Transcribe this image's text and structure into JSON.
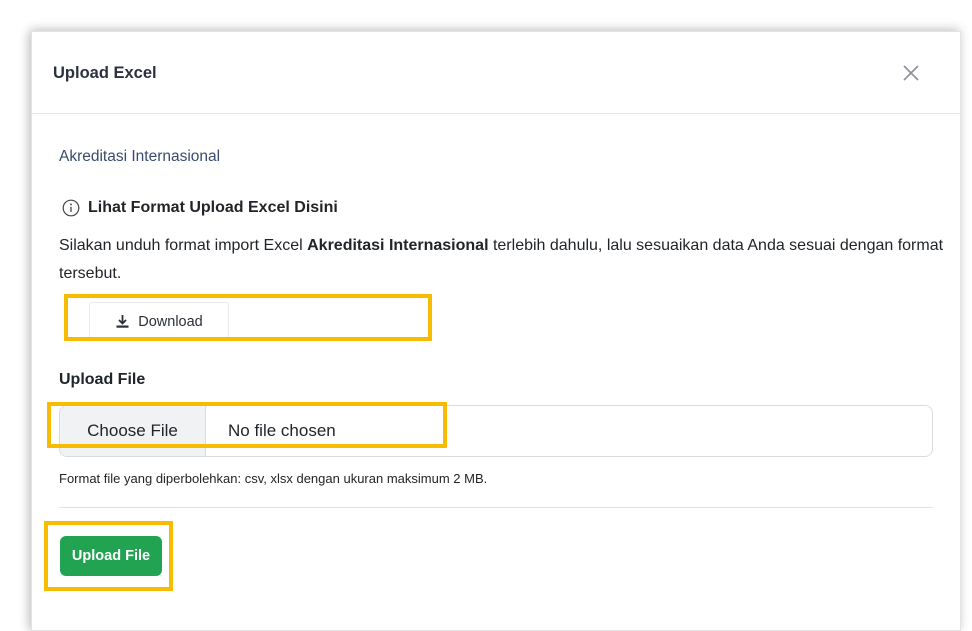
{
  "modal": {
    "title": "Upload Excel",
    "close_icon": "close-icon"
  },
  "body": {
    "subtitle": "Akreditasi Internasional",
    "info_icon": "info-circle-icon",
    "info_heading": "Lihat Format Upload Excel Disini",
    "description": {
      "before": "Silakan unduh format import Excel ",
      "bold": "Akreditasi Internasional",
      "after": " terlebih dahulu, lalu sesuaikan data Anda sesuai dengan format tersebut."
    },
    "download": {
      "icon": "download-icon",
      "label": "Download"
    }
  },
  "upload": {
    "label": "Upload File",
    "choose_button": "Choose File",
    "file_status": "No file chosen",
    "help_text": "Format file yang diperbolehkan: csv, xlsx dengan ukuran maksimum 2 MB.",
    "submit_label": "Upload File"
  },
  "colors": {
    "highlight": "#f7bb00",
    "submit_bg": "#22a352",
    "subtitle": "#3c4a6e"
  }
}
